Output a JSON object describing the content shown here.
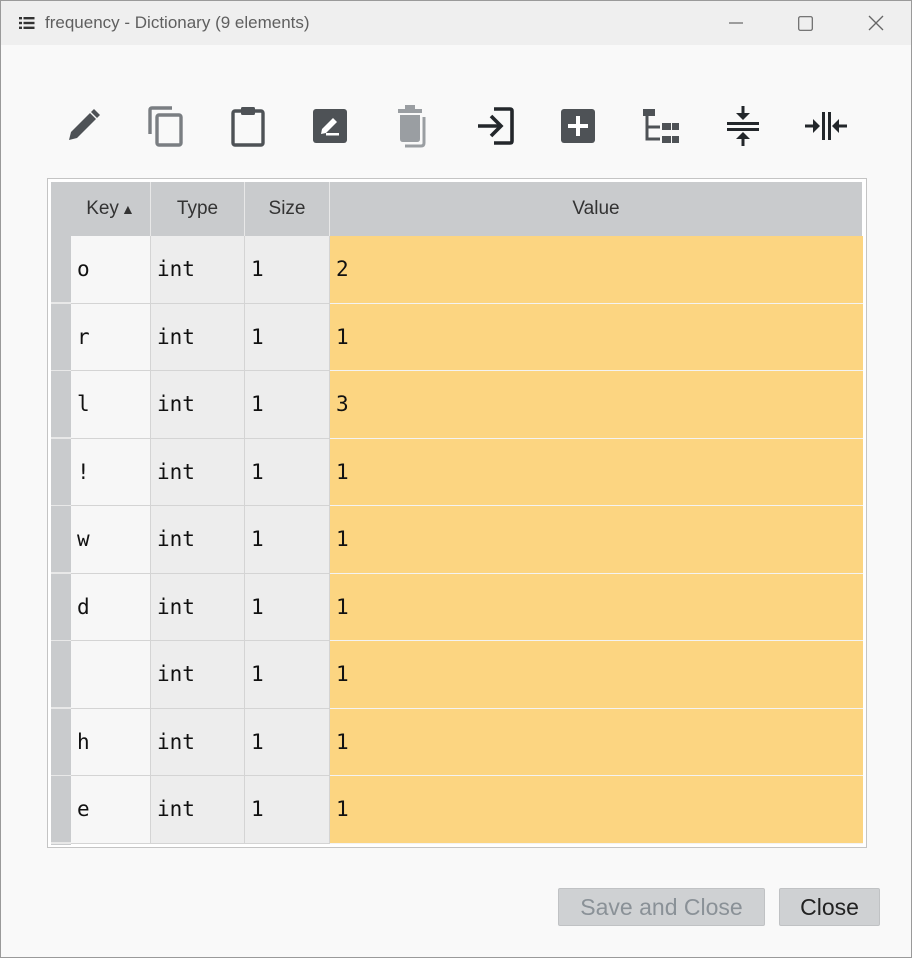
{
  "window": {
    "title": "frequency - Dictionary (9 elements)"
  },
  "toolbar": [
    {
      "name": "edit-button",
      "icon": "pencil-icon"
    },
    {
      "name": "copy-button",
      "icon": "copy-icon"
    },
    {
      "name": "paste-button",
      "icon": "clipboard-icon"
    },
    {
      "name": "rename-button",
      "icon": "rename-icon"
    },
    {
      "name": "delete-button",
      "icon": "trash-icon"
    },
    {
      "name": "insert-button",
      "icon": "insert-icon"
    },
    {
      "name": "add-button",
      "icon": "plus-box-icon"
    },
    {
      "name": "tree-button",
      "icon": "tree-icon"
    },
    {
      "name": "collapse-button",
      "icon": "collapse-icon"
    },
    {
      "name": "resize-columns-button",
      "icon": "resize-columns-icon"
    }
  ],
  "table": {
    "columns": [
      "Key",
      "Type",
      "Size",
      "Value"
    ],
    "sort_indicator": "▲",
    "rows": [
      {
        "key": "o",
        "type": "int",
        "size": "1",
        "value": "2"
      },
      {
        "key": "r",
        "type": "int",
        "size": "1",
        "value": "1"
      },
      {
        "key": "l",
        "type": "int",
        "size": "1",
        "value": "3"
      },
      {
        "key": "!",
        "type": "int",
        "size": "1",
        "value": "1"
      },
      {
        "key": "w",
        "type": "int",
        "size": "1",
        "value": "1"
      },
      {
        "key": "d",
        "type": "int",
        "size": "1",
        "value": "1"
      },
      {
        "key": " ",
        "type": "int",
        "size": "1",
        "value": "1"
      },
      {
        "key": "h",
        "type": "int",
        "size": "1",
        "value": "1"
      },
      {
        "key": "e",
        "type": "int",
        "size": "1",
        "value": "1"
      }
    ]
  },
  "buttons": {
    "save_and_close": "Save and Close",
    "close": "Close"
  },
  "colors": {
    "value_cell": "#fcd581",
    "header": "#c9cbcd",
    "icon": "#4e5256"
  }
}
